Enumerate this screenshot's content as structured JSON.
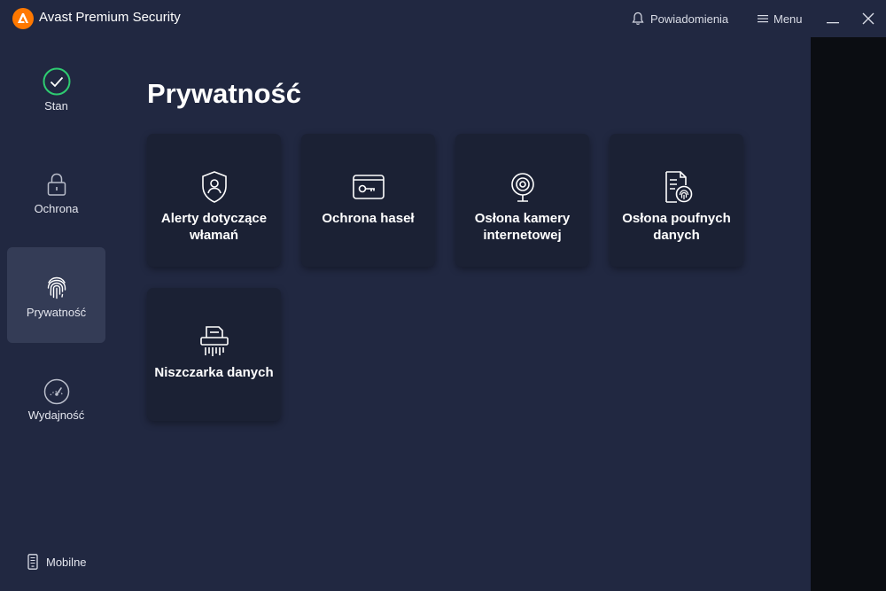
{
  "app": {
    "title": "Avast Premium Security"
  },
  "titlebar": {
    "notifications_label": "Powiadomienia",
    "menu_label": "Menu"
  },
  "colors": {
    "brand_orange": "#ff7800",
    "status_green": "#2ecc71",
    "background": "#212841",
    "tile_bg": "#1b2134",
    "active_nav_bg": "#343c56"
  },
  "sidebar": {
    "items": [
      {
        "label": "Stan",
        "icon": "check-circle-icon",
        "active": false
      },
      {
        "label": "Ochrona",
        "icon": "lock-icon",
        "active": false
      },
      {
        "label": "Prywatność",
        "icon": "fingerprint-icon",
        "active": true
      },
      {
        "label": "Wydajność",
        "icon": "speedometer-icon",
        "active": false
      }
    ],
    "mobile_label": "Mobilne"
  },
  "main": {
    "title": "Prywatność",
    "tiles": [
      {
        "label": "Alerty dotyczące włamań",
        "icon": "shield-user-icon"
      },
      {
        "label": "Ochrona haseł",
        "icon": "password-card-icon"
      },
      {
        "label": "Osłona kamery internetowej",
        "icon": "webcam-icon"
      },
      {
        "label": "Osłona poufnych danych",
        "icon": "document-fingerprint-icon"
      },
      {
        "label": "Niszczarka danych",
        "icon": "shredder-icon"
      }
    ]
  }
}
